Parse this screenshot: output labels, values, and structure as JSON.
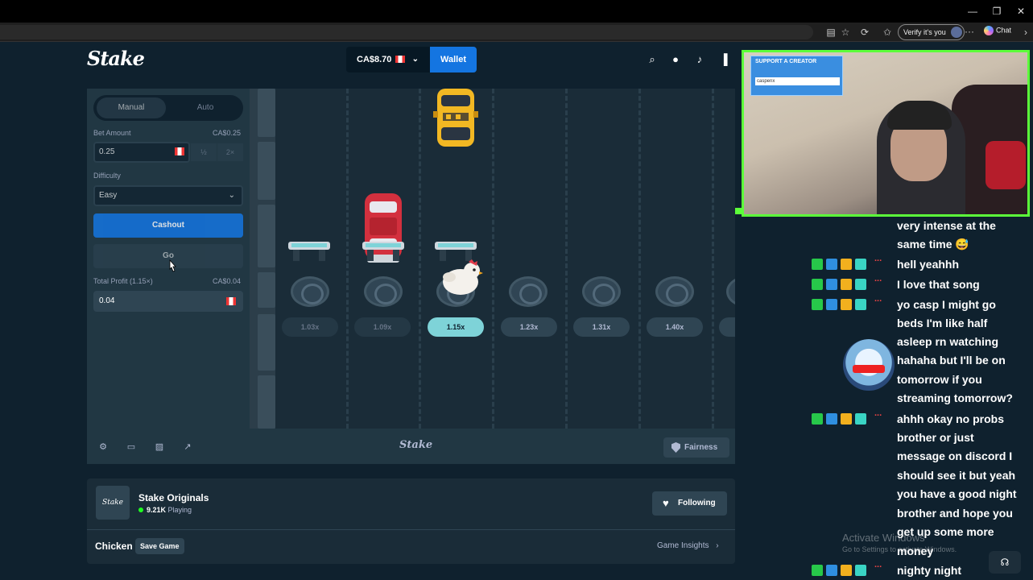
{
  "browser": {
    "verify_label": "Verify it's you",
    "chat_label": "Chat",
    "window_controls": [
      "—",
      "❐",
      "✕"
    ]
  },
  "header": {
    "logo": "Stake",
    "balance": "CA$8.70",
    "wallet_label": "Wallet"
  },
  "bet_panel": {
    "tabs": [
      "Manual",
      "Auto"
    ],
    "bet_amount_label": "Bet Amount",
    "bet_amount_value_display": "CA$0.25",
    "bet_amount_input": "0.25",
    "half_label": "½",
    "double_label": "2×",
    "difficulty_label": "Difficulty",
    "difficulty_value": "Easy",
    "cashout_label": "Cashout",
    "go_label": "Go",
    "total_profit_label": "Total Profit (1.15×)",
    "total_profit_display": "CA$0.04",
    "total_profit_value": "0.04"
  },
  "game": {
    "multipliers": [
      "1.03x",
      "1.09x",
      "1.15x",
      "1.23x",
      "1.31x",
      "1.40x"
    ],
    "active_index": 2,
    "colors": {
      "active": "#7ed3d8",
      "accent": "#1475e1",
      "bg": "#0f212e"
    }
  },
  "game_footer": {
    "logo": "Stake",
    "fairness_label": "Fairness"
  },
  "originals": {
    "logo_text": "Stake",
    "title": "Stake Originals",
    "playing_count": "9.21K",
    "playing_label": "Playing",
    "following_label": "Following",
    "game_name": "Chicken",
    "save_game_label": "Save Game",
    "insights_label": "Game Insights"
  },
  "webcam": {
    "overlay_title": "SUPPORT A CREATOR",
    "overlay_user": "caspenx"
  },
  "chat": {
    "lines": [
      "very intense at the",
      "same time 😅",
      "hell yeahhh",
      "I love that song",
      "yo casp I might go",
      "beds I'm like half",
      "asleep rn watching",
      "hahaha but I'll be on",
      "tomorrow if you",
      "streaming tomorrow?",
      "ahhh okay no probs",
      "brother or just",
      "message on discord I",
      "should see it but yeah",
      "you have a good night",
      "brother and hope you",
      "get up some more",
      "money",
      "nighty night"
    ],
    "badge_colors": [
      "#27c84a",
      "#2f8fe0",
      "#f2b01e",
      "#3ad4c4"
    ]
  },
  "os_watermark": {
    "line1": "Activate Windows",
    "line2": "Go to Settings to activate Windows."
  }
}
